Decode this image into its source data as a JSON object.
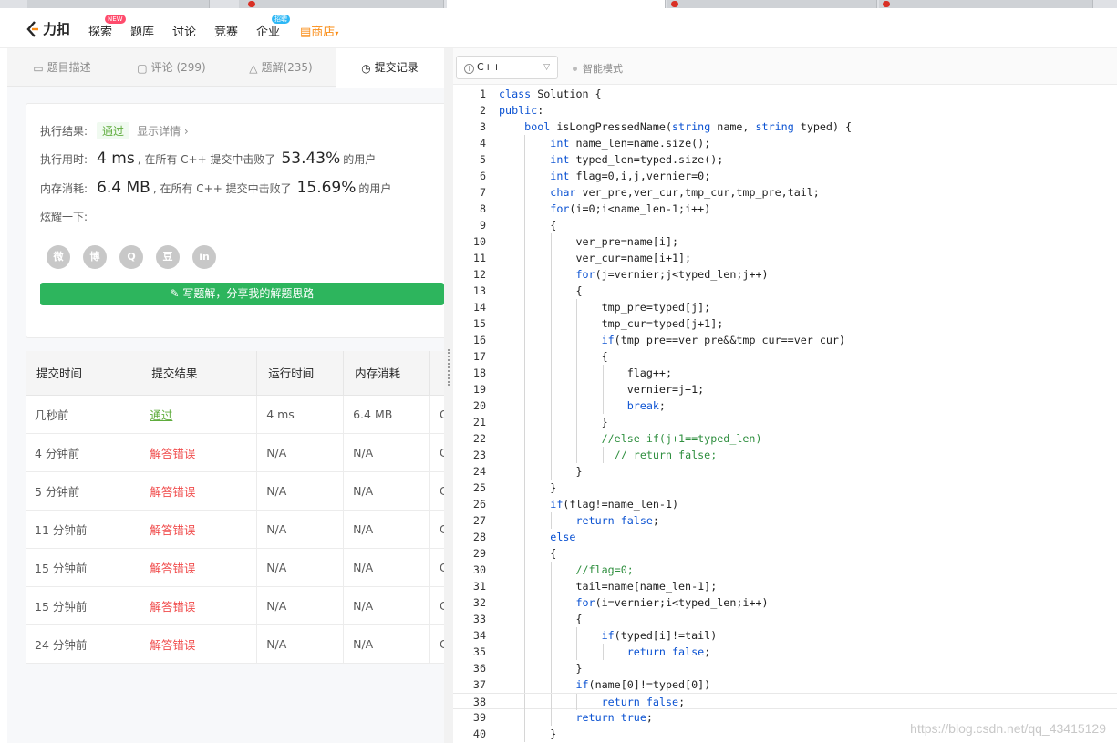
{
  "navbar": {
    "logo": "力扣",
    "items": [
      "探索",
      "题库",
      "讨论",
      "竞赛",
      "企业"
    ],
    "explore_badge": "NEW",
    "enterprise_badge": "招聘",
    "shop": "商店"
  },
  "left_tabs": [
    "题目描述",
    "评论 (299)",
    "题解(235)",
    "提交记录"
  ],
  "result": {
    "label_result": "执行结果:",
    "status": "通过",
    "detail_link": "显示详情",
    "label_time": "执行用时:",
    "time": "4 ms",
    "time_text": ", 在所有 C++ 提交中击败了",
    "time_pct": "53.43%",
    "time_suffix": "的用户",
    "label_mem": "内存消耗:",
    "mem": "6.4 MB",
    "mem_text": ", 在所有 C++ 提交中击败了",
    "mem_pct": "15.69%",
    "mem_suffix": "的用户",
    "share_label": "炫耀一下:",
    "share_icons": [
      "wechat-icon",
      "weibo-icon",
      "qq-icon",
      "douban-icon",
      "linkedin-icon"
    ],
    "share_glyphs": [
      "微",
      "博",
      "Q",
      "豆",
      "in"
    ],
    "solution_button": "写题解，分享我的解题思路"
  },
  "submissions": {
    "headers": [
      "提交时间",
      "提交结果",
      "运行时间",
      "内存消耗"
    ],
    "rows": [
      {
        "time": "几秒前",
        "result": "通过",
        "runtime": "4 ms",
        "memory": "6.4 MB",
        "lang": "C"
      },
      {
        "time": "4 分钟前",
        "result": "解答错误",
        "runtime": "N/A",
        "memory": "N/A",
        "lang": "C"
      },
      {
        "time": "5 分钟前",
        "result": "解答错误",
        "runtime": "N/A",
        "memory": "N/A",
        "lang": "C"
      },
      {
        "time": "11 分钟前",
        "result": "解答错误",
        "runtime": "N/A",
        "memory": "N/A",
        "lang": "C"
      },
      {
        "time": "15 分钟前",
        "result": "解答错误",
        "runtime": "N/A",
        "memory": "N/A",
        "lang": "C"
      },
      {
        "time": "15 分钟前",
        "result": "解答错误",
        "runtime": "N/A",
        "memory": "N/A",
        "lang": "C"
      },
      {
        "time": "24 分钟前",
        "result": "解答错误",
        "runtime": "N/A",
        "memory": "N/A",
        "lang": "C"
      }
    ]
  },
  "editor": {
    "language": "C++",
    "smart_mode": "智能模式",
    "current_line": 38,
    "lines": [
      "class Solution {",
      "public:",
      "    bool isLongPressedName(string name, string typed) {",
      "        int name_len=name.size();",
      "        int typed_len=typed.size();",
      "        int flag=0,i,j,vernier=0;",
      "        char ver_pre,ver_cur,tmp_cur,tmp_pre,tail;",
      "        for(i=0;i<name_len-1;i++)",
      "        {",
      "            ver_pre=name[i];",
      "            ver_cur=name[i+1];",
      "            for(j=vernier;j<typed_len;j++)",
      "            {",
      "                tmp_pre=typed[j];",
      "                tmp_cur=typed[j+1];",
      "                if(tmp_pre==ver_pre&&tmp_cur==ver_cur)",
      "                {",
      "                    flag++;",
      "                    vernier=j+1;",
      "                    break;",
      "                }",
      "                //else if(j+1==typed_len)",
      "                  // return false;",
      "            }",
      "        }",
      "        if(flag!=name_len-1)",
      "            return false;",
      "        else",
      "        {",
      "            //flag=0;",
      "            tail=name[name_len-1];",
      "            for(i=vernier;i<typed_len;i++)",
      "            {",
      "                if(typed[i]!=tail)",
      "                    return false;",
      "            }",
      "            if(name[0]!=typed[0])",
      "                return false;",
      "            return true;",
      "        }"
    ]
  },
  "watermark": "https://blog.csdn.net/qq_43415129"
}
